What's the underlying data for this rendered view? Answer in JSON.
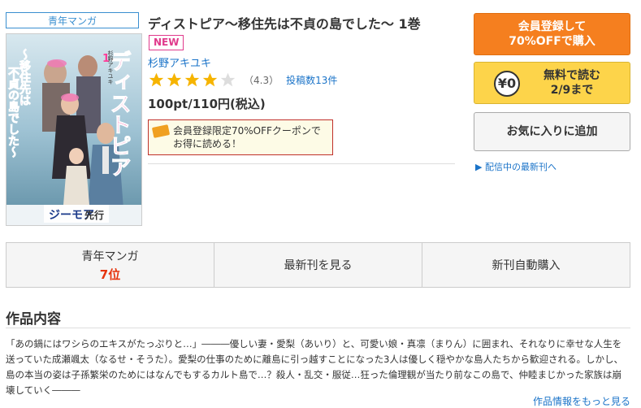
{
  "genre_tag": "青年マンガ",
  "cover": {
    "title_vertical": "ディストピア〜移住先は不貞の島でした〜",
    "volume": "1",
    "author_vertical": "杉野アキユキ",
    "publisher_logo": "ジーモア",
    "label": "先行"
  },
  "book": {
    "title": "ディストピア〜移住先は不貞の島でした〜 1巻",
    "badge": "NEW",
    "author": "杉野アキユキ",
    "rating": 4.3,
    "rating_text": "（4.3）",
    "review_count": "投稿数13件",
    "price": "100pt/110円(税込)",
    "coupon": "会員登録限定70%OFFクーポンで お得に読める！"
  },
  "buttons": {
    "purchase_line1": "会員登録して",
    "purchase_line2": "70%OFFで購入",
    "free_coin": "¥0",
    "free_line1": "無料で読む",
    "free_line2": "2/9まで",
    "favorite": "お気に入りに追加",
    "latest_link": "▶ 配信中の最新刊へ"
  },
  "tabs": {
    "ranking_genre": "青年マンガ",
    "ranking_value": "7位",
    "latest": "最新刊を見る",
    "auto_buy": "新刊自動購入"
  },
  "section": {
    "title": "作品内容",
    "description": "「あの鍋にはワシらのエキスがたっぷりと…」―――優しい妻・愛梨（あいり）と、可愛い娘・真凛（まりん）に囲まれ、それなりに幸せな人生を送っていた成瀬颯太（なるせ・そうた）。愛梨の仕事のために離島に引っ越すことになった3人は優しく穏やかな島人たちから歓迎される。しかし、島の本当の姿は子孫繁栄のためにはなんでもするカルト島で…？殺人・乱交・服従…狂った倫理観が当たり前なこの島で、仲睦まじかった家族は崩壊していく―――",
    "more_link": "作品情報をもっと見る"
  },
  "colors": {
    "accent_blue": "#1a73c8",
    "orange": "#f57f1f",
    "yellow": "#fdd44a",
    "pink": "#e03a8c",
    "red": "#e6350f"
  }
}
